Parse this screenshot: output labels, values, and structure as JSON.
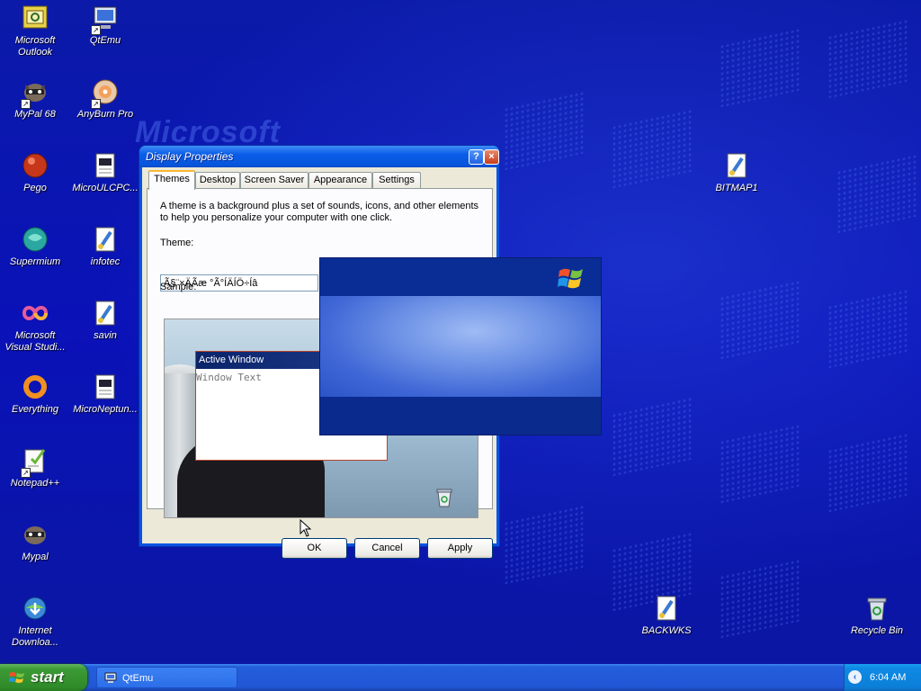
{
  "desktop": {
    "wallpaper_text": "Microsoft",
    "icons": [
      {
        "label": "Microsoft Outlook",
        "icon": "outlook-icon"
      },
      {
        "label": "QtEmu",
        "icon": "computer-icon"
      },
      {
        "label": "MyPal 68",
        "icon": "raccoon-icon"
      },
      {
        "label": "AnyBurn Pro",
        "icon": "disc-icon"
      },
      {
        "label": "Pego",
        "icon": "red-ball-icon"
      },
      {
        "label": "MicroULCPC...",
        "icon": "document-icon"
      },
      {
        "label": "Supermium",
        "icon": "globe-icon"
      },
      {
        "label": "infotec",
        "icon": "paint-icon"
      },
      {
        "label": "Microsoft Visual Studi...",
        "icon": "infinity-icon"
      },
      {
        "label": "savin",
        "icon": "paint-icon"
      },
      {
        "label": "Everything",
        "icon": "ring-icon"
      },
      {
        "label": "MicroNeptun...",
        "icon": "document-icon"
      },
      {
        "label": "Notepad++",
        "icon": "notepad-icon"
      },
      {
        "label": "Mypal",
        "icon": "raccoon-icon"
      },
      {
        "label": "Internet Downloa...",
        "icon": "download-globe-icon"
      },
      {
        "label": "BITMAP1",
        "icon": "paint-icon"
      },
      {
        "label": "BACKWKS",
        "icon": "paint-icon"
      },
      {
        "label": "Recycle Bin",
        "icon": "recycle-bin-icon"
      }
    ]
  },
  "dialog": {
    "title": "Display Properties",
    "help_label": "?",
    "close_label": "×",
    "tabs": [
      "Themes",
      "Desktop",
      "Screen Saver",
      "Appearance",
      "Settings"
    ],
    "active_tab": "Themes",
    "description": "A theme is a background plus a set of sounds, icons, and other elements to help you personalize your computer with one click.",
    "theme_label": "Theme:",
    "theme_value": "Ã§¨×ÄÃæ °Ã°ÍÄÍÖ÷Íâ",
    "sample_label": "Sample:",
    "sample_window_title": "Active Window",
    "sample_window_text": "Window Text",
    "buttons": {
      "ok": "OK",
      "cancel": "Cancel",
      "apply": "Apply"
    }
  },
  "taskbar": {
    "start_label": "start",
    "task_label": "QtEmu",
    "clock": "6:04 AM",
    "tray_expand": "‹"
  },
  "colors": {
    "desktop_blue": "#0a14b4",
    "taskbar_blue": "#245edb",
    "start_green": "#3c9a35",
    "window_face": "#ece9d8"
  }
}
